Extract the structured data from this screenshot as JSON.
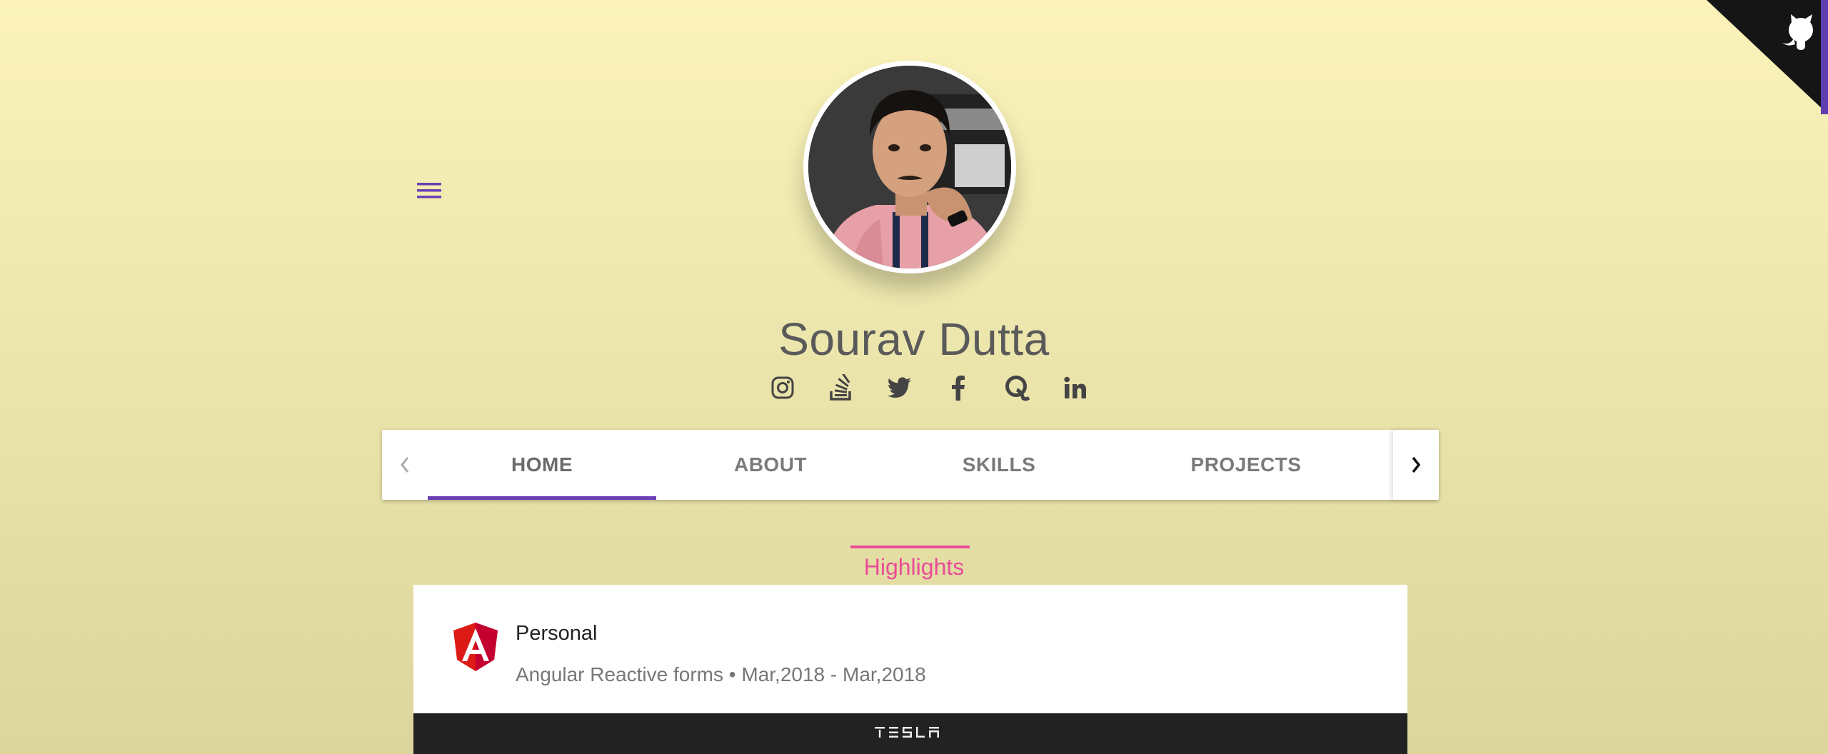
{
  "profile": {
    "name": "Sourav Dutta"
  },
  "social": [
    {
      "icon": "instagram-icon"
    },
    {
      "icon": "stackoverflow-icon"
    },
    {
      "icon": "twitter-icon"
    },
    {
      "icon": "facebook-icon"
    },
    {
      "icon": "quora-icon"
    },
    {
      "icon": "linkedin-icon"
    }
  ],
  "tabs": {
    "items": [
      {
        "label": "HOME",
        "active": true
      },
      {
        "label": "ABOUT",
        "active": false
      },
      {
        "label": "SKILLS",
        "active": false
      },
      {
        "label": "PROJECTS",
        "active": false
      }
    ]
  },
  "highlights": {
    "title": "Highlights",
    "card": {
      "title": "Personal",
      "subtitle": "Angular Reactive forms • Mar,2018 - Mar,2018",
      "logo": "angular-logo-icon"
    },
    "next_card_brand": "TESLA"
  },
  "colors": {
    "accent": "#6a3fb5",
    "highlight": "#ea4c97",
    "angular_red": "#dd1b16",
    "corner": "#151515"
  }
}
